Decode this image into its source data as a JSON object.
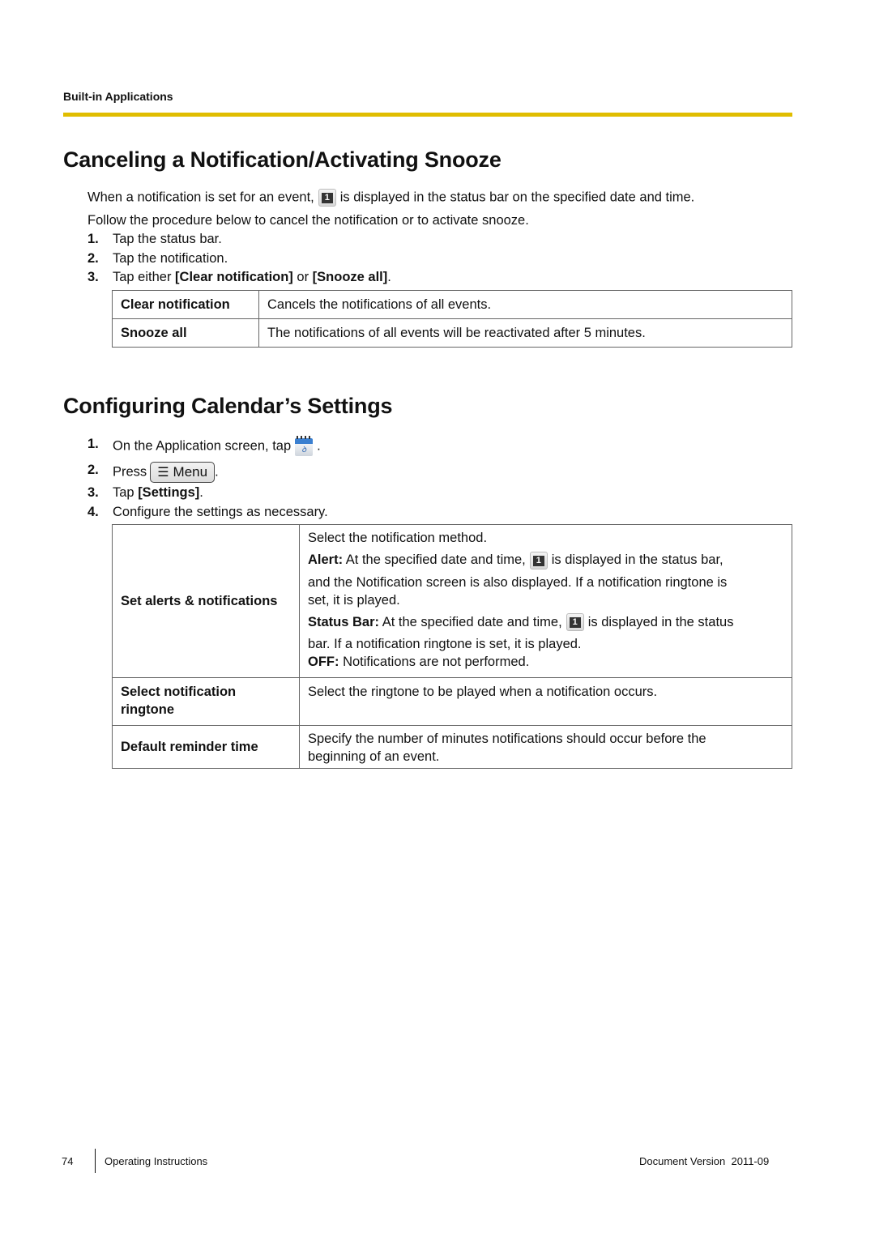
{
  "header": {
    "running_head": "Built-in Applications",
    "rule_color": "#e0bd00"
  },
  "section1": {
    "title": "Canceling a Notification/Activating Snooze",
    "intro_before_icon": "When a notification is set for an event,",
    "intro_after_icon": "is displayed in the status bar on the specified date and time.",
    "intro2": "Follow the procedure below to cancel the notification or to activate snooze.",
    "icon": "calendar-notification-icon",
    "icon_glyph": "1",
    "steps": [
      {
        "num": "1.",
        "text": "Tap the status bar."
      },
      {
        "num": "2.",
        "text": "Tap the notification."
      },
      {
        "num": "3.",
        "pre": "Tap either ",
        "b1": "[Clear notification]",
        "mid": " or ",
        "b2": "[Snooze all]",
        "post": "."
      }
    ],
    "table": [
      {
        "key": "Clear notification",
        "value": "Cancels the notifications of all events."
      },
      {
        "key": "Snooze all",
        "value": "The notifications of all events will be reactivated after 5 minutes."
      }
    ]
  },
  "section2": {
    "title": "Configuring Calendar’s Settings",
    "steps": [
      {
        "num": "1.",
        "text": "On the Application screen, tap",
        "icon": "calendar-app-icon",
        "post": "."
      },
      {
        "num": "2.",
        "text": "Press",
        "button": "Menu",
        "button_icon": "menu-list-icon",
        "post": "."
      },
      {
        "num": "3.",
        "pre": "Tap ",
        "bold": "[Settings]",
        "post": "."
      },
      {
        "num": "4.",
        "text": "Configure the settings as necessary."
      }
    ],
    "table": {
      "alerts": {
        "key": "Set alerts & notifications",
        "line1": "Select the notification method.",
        "alert_label": "Alert:",
        "alert_pre": " At the specified date and time,",
        "alert_post": "is displayed in the status bar,",
        "alert_line2": "and the Notification screen is also displayed. If a notification ringtone is",
        "alert_line3": "set, it is played.",
        "status_label": "Status Bar:",
        "status_pre": " At the specified date and time,",
        "status_post": "is displayed in the status",
        "status_line2": "bar. If a notification ringtone is set, it is played.",
        "off_label": "OFF:",
        "off_text": " Notifications are not performed."
      },
      "ringtone": {
        "key1": "Select notification",
        "key2": "ringtone",
        "value": "Select the ringtone to be played when a notification occurs."
      },
      "reminder": {
        "key": "Default reminder time",
        "value1": "Specify the number of minutes notifications should occur before the",
        "value2": "beginning of an event."
      }
    }
  },
  "footer": {
    "page_number": "74",
    "doc_title": "Operating Instructions",
    "version_label": "Document Version",
    "version": "2011-09"
  }
}
